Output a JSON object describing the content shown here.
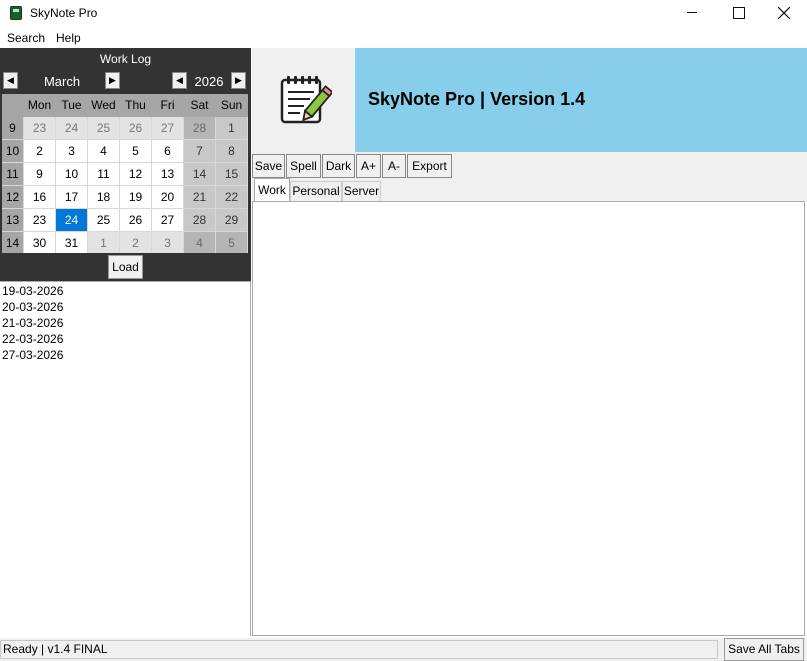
{
  "window": {
    "title": "SkyNote Pro",
    "icon": "app-notebook-icon"
  },
  "menu": {
    "items": [
      "Search",
      "Help"
    ]
  },
  "calendar": {
    "header": "Work Log",
    "month": "March",
    "year": "2026",
    "weekday_headers": [
      "Mon",
      "Tue",
      "Wed",
      "Thu",
      "Fri",
      "Sat",
      "Sun"
    ],
    "weeks": [
      {
        "week": "9",
        "days": [
          "23",
          "24",
          "25",
          "26",
          "27",
          "28",
          "1"
        ]
      },
      {
        "week": "10",
        "days": [
          "2",
          "3",
          "4",
          "5",
          "6",
          "7",
          "8"
        ]
      },
      {
        "week": "11",
        "days": [
          "9",
          "10",
          "11",
          "12",
          "13",
          "14",
          "15"
        ]
      },
      {
        "week": "12",
        "days": [
          "16",
          "17",
          "18",
          "19",
          "20",
          "21",
          "22"
        ]
      },
      {
        "week": "13",
        "days": [
          "23",
          "24",
          "25",
          "26",
          "27",
          "28",
          "29"
        ]
      },
      {
        "week": "14",
        "days": [
          "30",
          "31",
          "1",
          "2",
          "3",
          "4",
          "5"
        ]
      }
    ],
    "selected_day": "24",
    "load_label": "Load"
  },
  "date_list": [
    "19-03-2026",
    "20-03-2026",
    "21-03-2026",
    "22-03-2026",
    "27-03-2026"
  ],
  "banner": {
    "title": "SkyNote Pro | Version 1.4",
    "logo_icon": "notepad-pencil-icon",
    "color": "#87ceeb"
  },
  "toolbar": {
    "save": "Save",
    "spell": "Spell",
    "dark": "Dark",
    "font_up": "A+",
    "font_down": "A-",
    "export": "Export"
  },
  "tabs": [
    {
      "label": "Work",
      "active": true
    },
    {
      "label": "Personal",
      "active": false
    },
    {
      "label": "Server",
      "active": false
    }
  ],
  "editor": {
    "content": ""
  },
  "status": {
    "text": "Ready | v1.4 FINAL",
    "save_all_label": "Save All Tabs"
  },
  "colors": {
    "calendar_bg": "#333333",
    "selected_day": "#0078d7",
    "banner": "#87ceeb"
  }
}
